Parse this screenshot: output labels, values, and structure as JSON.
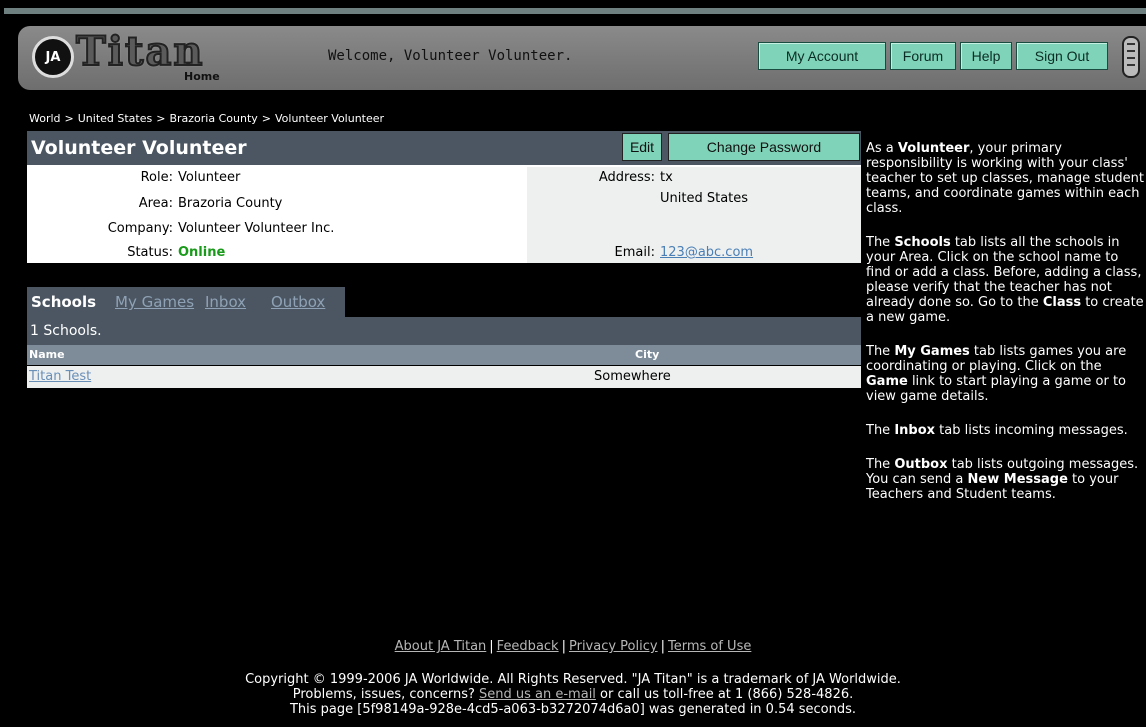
{
  "header": {
    "logo_badge": "JA",
    "logo_text": "Titan",
    "logo_sub": "Home",
    "welcome": "Welcome, Volunteer Volunteer.",
    "nav": [
      {
        "label": "My Account"
      },
      {
        "label": "Forum"
      },
      {
        "label": "Help"
      },
      {
        "label": "Sign Out"
      }
    ]
  },
  "breadcrumb": [
    "World",
    "United States",
    "Brazoria County",
    "Volunteer Volunteer"
  ],
  "profile": {
    "name": "Volunteer Volunteer",
    "edit_label": "Edit",
    "change_password_label": "Change Password",
    "role_label": "Role:",
    "role": "Volunteer",
    "area_label": "Area:",
    "area": "Brazoria County",
    "company_label": "Company:",
    "company": "Volunteer Volunteer Inc.",
    "status_label": "Status:",
    "status": "Online",
    "address_label": "Address:",
    "address_line1": "tx",
    "address_line2": "United States",
    "email_label": "Email:",
    "email": "123@abc.com"
  },
  "tabs": [
    {
      "label": "Schools",
      "active": true
    },
    {
      "label": "My Games",
      "active": false
    },
    {
      "label": "Inbox",
      "active": false
    },
    {
      "label": "Outbox",
      "active": false
    }
  ],
  "schools": {
    "count_text": "1 Schools.",
    "col_name": "Name",
    "col_city": "City",
    "rows": [
      {
        "name": "Titan Test",
        "city": "Somewhere"
      }
    ]
  },
  "help": {
    "p1_a": "As a ",
    "p1_b": "Volunteer",
    "p1_c": ", your primary responsibility is working with your class' teacher to set up classes, manage student teams, and coordinate games within each class.",
    "p2_a": "The ",
    "p2_b": "Schools",
    "p2_c": " tab lists all the schools in your Area. Click on the school name to find or add a class. Before, adding a class, please verify that the teacher has not already done so. Go to the ",
    "p2_d": "Class",
    "p2_e": " to create a new game.",
    "p3_a": "The ",
    "p3_b": "My Games",
    "p3_c": " tab lists games you are coordinating or playing. Click on the ",
    "p3_d": "Game",
    "p3_e": " link to start playing a game or to view game details.",
    "p4_a": "The ",
    "p4_b": "Inbox",
    "p4_c": " tab lists incoming messages.",
    "p5_a": "The ",
    "p5_b": "Outbox",
    "p5_c": " tab lists outgoing messages. You can send a ",
    "p5_d": "New Message",
    "p5_e": " to your Teachers and Student teams."
  },
  "footer": {
    "links": [
      "About JA Titan",
      "Feedback",
      "Privacy Policy",
      "Terms of Use"
    ],
    "copyright": "Copyright © 1999-2006 JA Worldwide. All Rights Reserved. \"JA Titan\" is a trademark of JA Worldwide.",
    "problems_a": "Problems, issues, concerns? ",
    "problems_link": "Send us an e-mail",
    "problems_b": " or call us toll-free at 1 (866) 528-4826.",
    "generated": "This page [5f98149a-928e-4cd5-a063-b3272074d6a0] was generated in 0.54 seconds."
  },
  "colors": {
    "button": "#7fd3b8",
    "panel": "#4b5662",
    "online": "#1a9a1a",
    "link": "#4a7fb5"
  }
}
